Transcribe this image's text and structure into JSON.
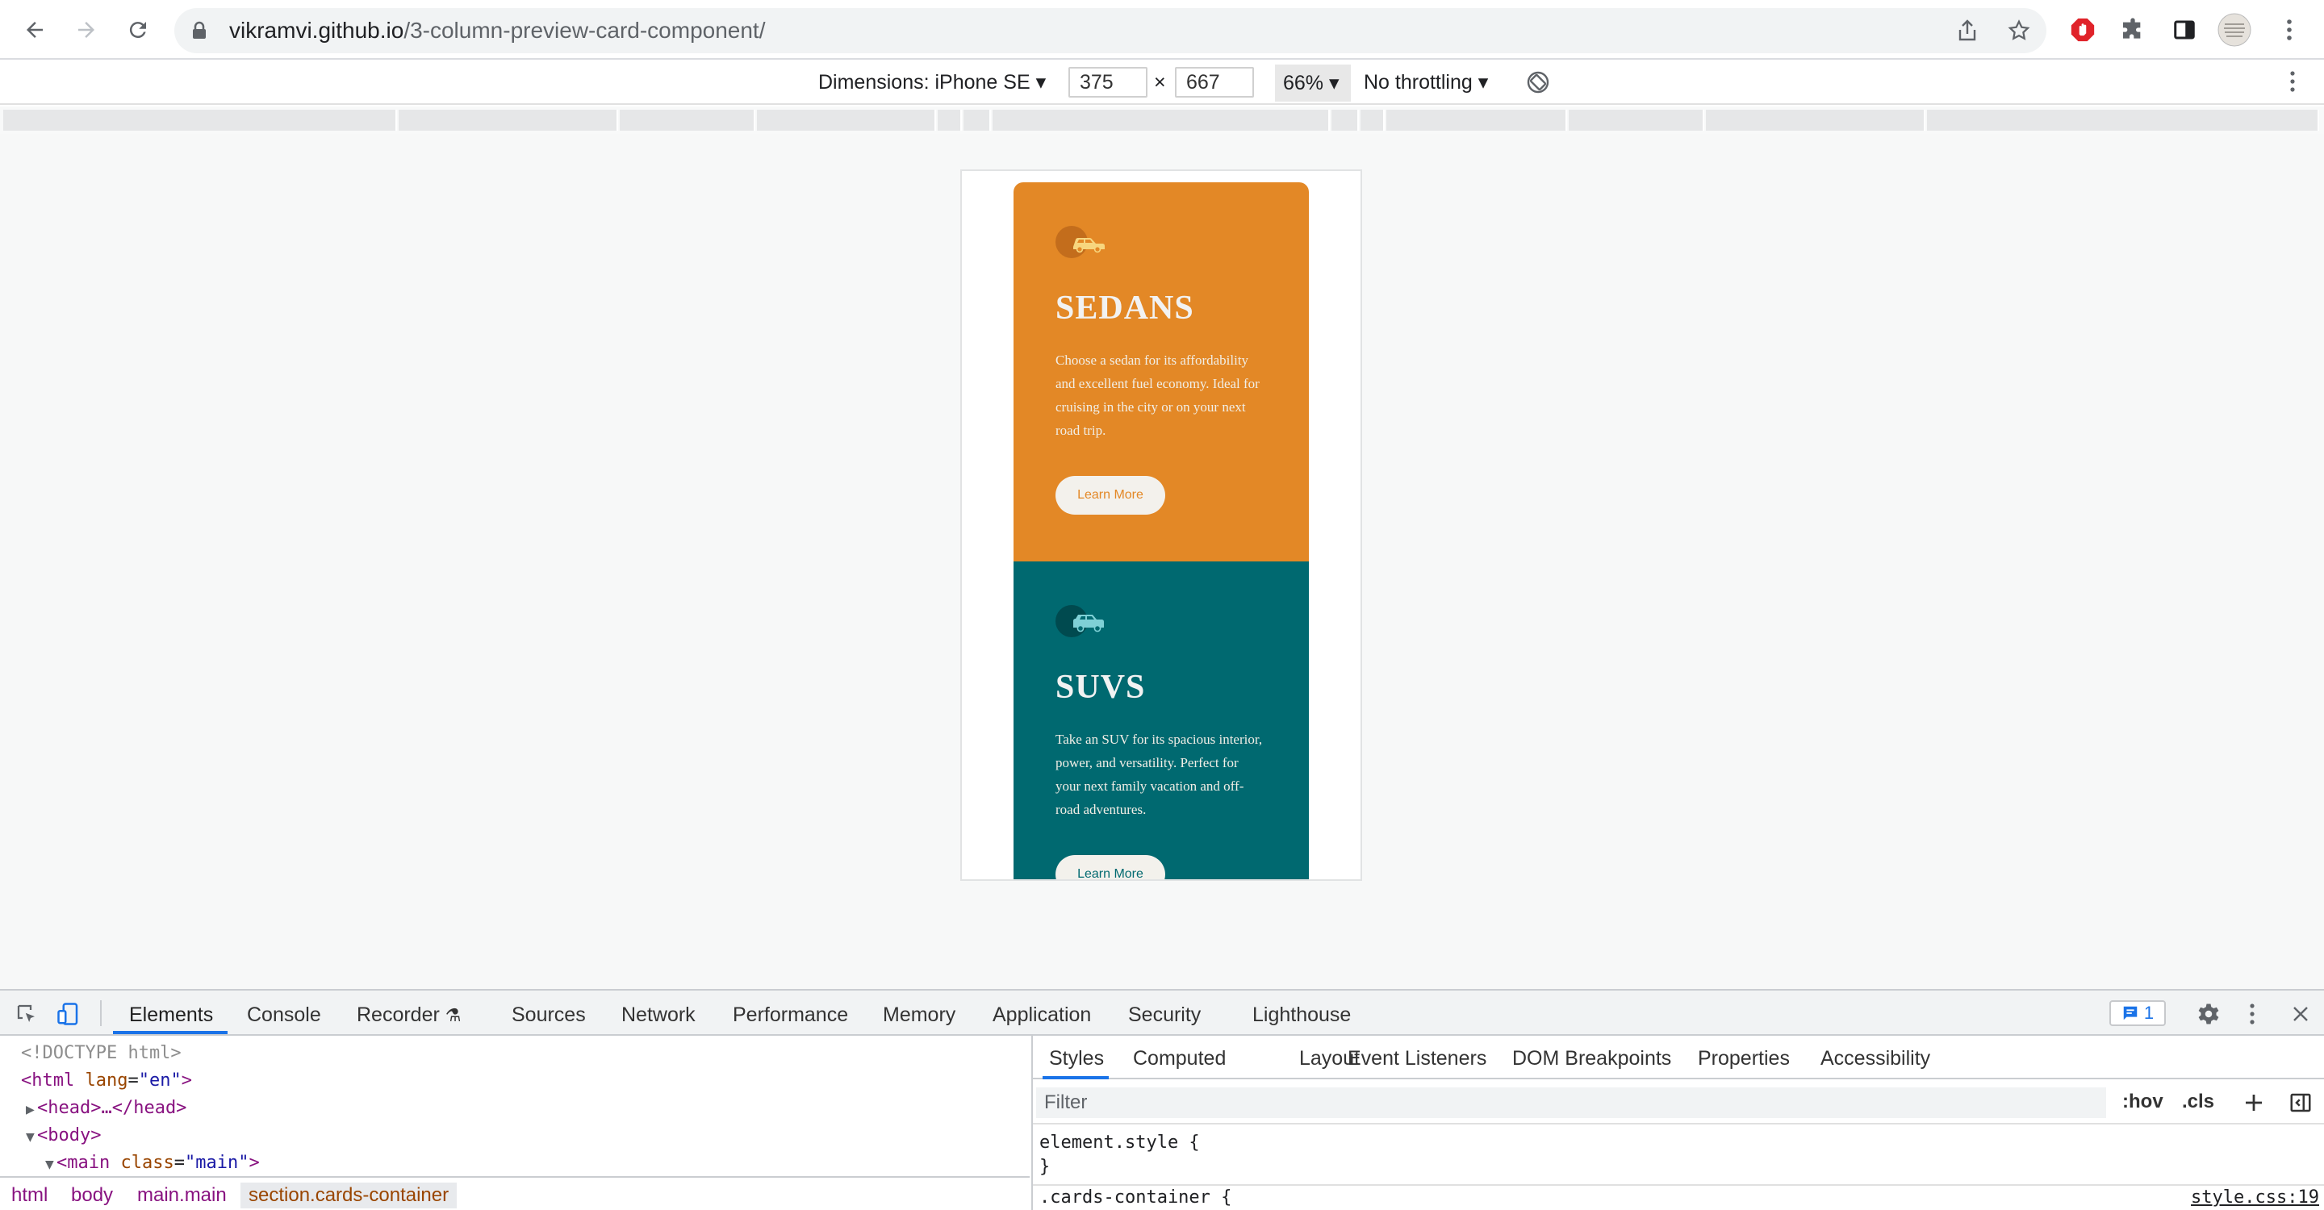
{
  "browser": {
    "url_host": "vikramvi.github.io",
    "url_path": "/3-column-preview-card-component/"
  },
  "device_toolbar": {
    "dimensions_label": "Dimensions: iPhone SE",
    "width": "375",
    "times": "×",
    "height": "667",
    "zoom": "66%",
    "throttling": "No throttling"
  },
  "cards": [
    {
      "title": "SEDANS",
      "text": "Choose a sedan for its affordability and excellent fuel economy. Ideal for cruising in the city or on your next road trip.",
      "button": "Learn More",
      "color": "#e38826",
      "icon": "sedan-car-icon"
    },
    {
      "title": "SUVS",
      "text": "Take an SUV for its spacious interior, power, and versatility. Perfect for your next family vacation and off-road adventures.",
      "button": "Learn More",
      "color": "#006970",
      "icon": "suv-car-icon"
    }
  ],
  "devtools": {
    "tabs": [
      "Elements",
      "Console",
      "Recorder",
      "Sources",
      "Network",
      "Performance",
      "Memory",
      "Application",
      "Security",
      "Lighthouse"
    ],
    "issues_count": "1",
    "dom": {
      "doctype": "<!DOCTYPE html>",
      "html_open": "<html",
      "html_attr": "lang",
      "html_val": "\"en\"",
      "head": "<head>…</head>",
      "body": "<body>",
      "main_open": "<main",
      "main_attr": "class",
      "main_val": "\"main\""
    },
    "breadcrumbs": [
      "html",
      "body",
      "main.main",
      "section.cards-container"
    ],
    "styles_tabs": [
      "Styles",
      "Computed",
      "Layout",
      "Event Listeners",
      "DOM Breakpoints",
      "Properties",
      "Accessibility"
    ],
    "filter_placeholder": "Filter",
    "hov": ":hov",
    "cls": ".cls",
    "rule1_open": "element.style {",
    "rule1_close": "}",
    "rule2_open": ".cards-container {",
    "rule2_source": "style.css:19"
  },
  "colors": {
    "accent": "#1a73e8",
    "sedan": "#e38826",
    "suv": "#006970"
  }
}
